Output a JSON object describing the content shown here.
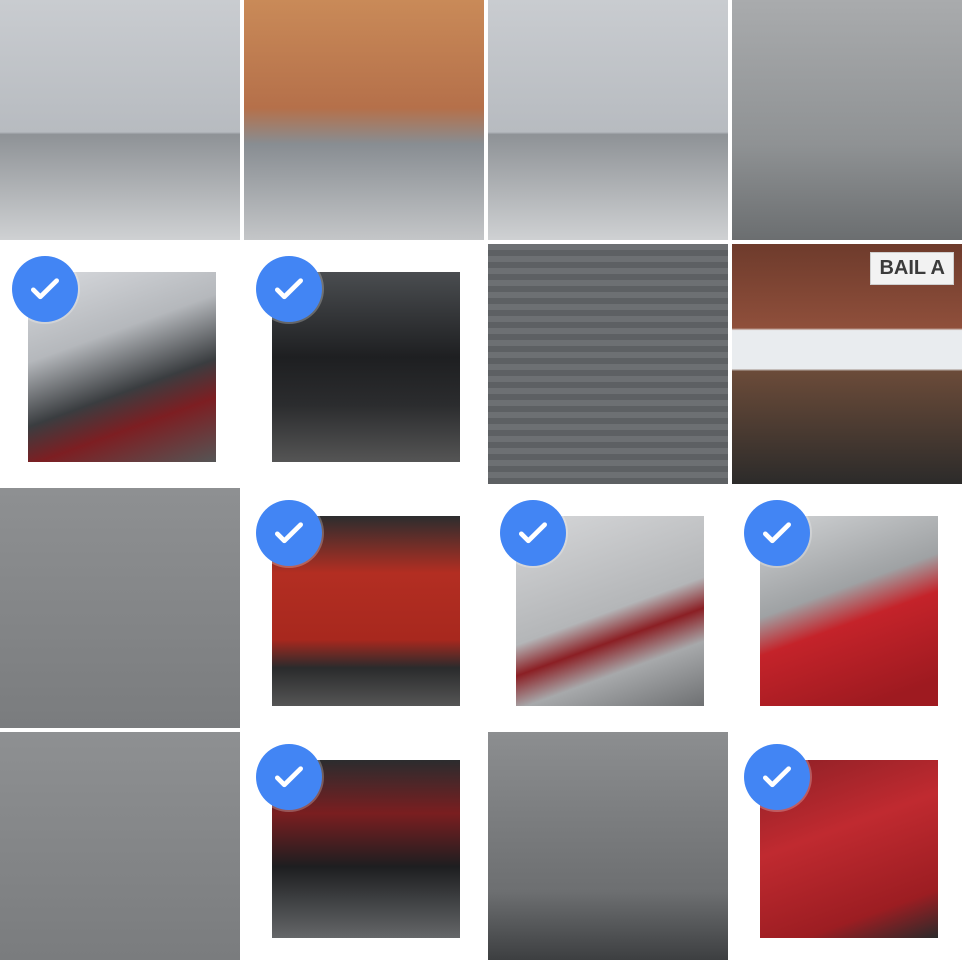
{
  "captcha": {
    "rows": 4,
    "cols": 4,
    "accent_color": "#4285f4",
    "tiles": [
      {
        "id": "r1c1",
        "selected": false,
        "scene": "wall-top"
      },
      {
        "id": "r1c2",
        "selected": false,
        "scene": "sign-warm"
      },
      {
        "id": "r1c3",
        "selected": false,
        "scene": "wall-top"
      },
      {
        "id": "r1c4",
        "selected": false,
        "scene": "wall-grey"
      },
      {
        "id": "r2c1",
        "selected": true,
        "scene": "cars-white"
      },
      {
        "id": "r2c2",
        "selected": true,
        "scene": "black-car"
      },
      {
        "id": "r2c3",
        "selected": false,
        "scene": "shutter"
      },
      {
        "id": "r2c4",
        "selected": false,
        "scene": "sign-bail",
        "sign_text": "BAIL A"
      },
      {
        "id": "r3c1",
        "selected": false,
        "scene": "road"
      },
      {
        "id": "r3c2",
        "selected": true,
        "scene": "red-rider"
      },
      {
        "id": "r3c3",
        "selected": true,
        "scene": "silver-car"
      },
      {
        "id": "r3c4",
        "selected": true,
        "scene": "red-car"
      },
      {
        "id": "r4c1",
        "selected": false,
        "scene": "road"
      },
      {
        "id": "r4c2",
        "selected": true,
        "scene": "scooter"
      },
      {
        "id": "r4c3",
        "selected": false,
        "scene": "road-edge"
      },
      {
        "id": "r4c4",
        "selected": true,
        "scene": "red-car2"
      }
    ]
  }
}
